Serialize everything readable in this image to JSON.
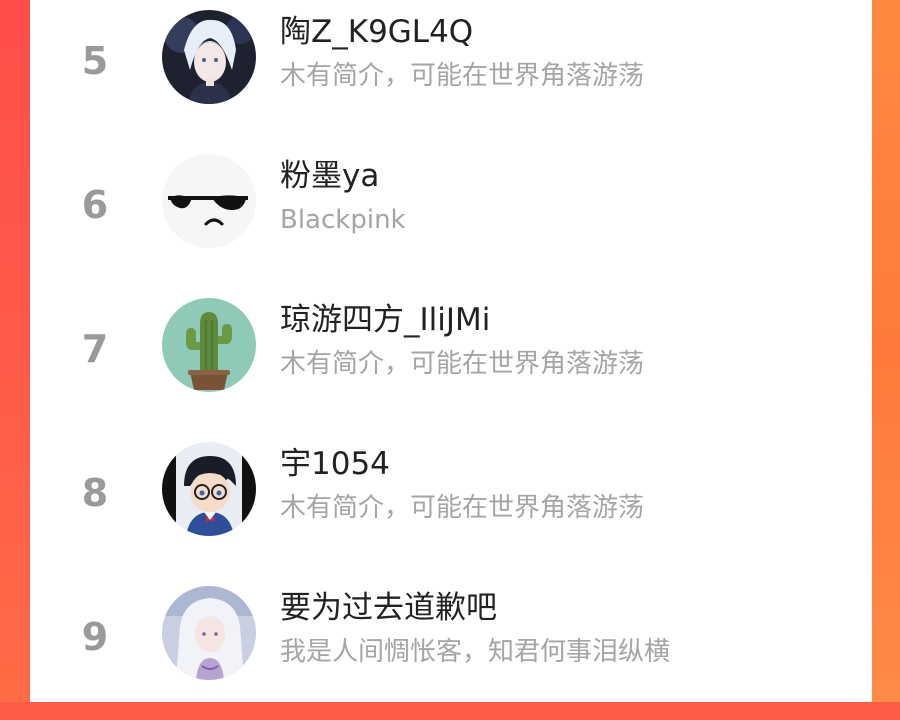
{
  "ranking": {
    "items": [
      {
        "rank": "5",
        "name": "陶Z_K9GL4Q",
        "desc": "木有简介，可能在世界角落游荡",
        "avatar": "anime-boy-avatar"
      },
      {
        "rank": "6",
        "name": "粉墨ya",
        "desc": "Blackpink",
        "avatar": "sunglasses-face-avatar"
      },
      {
        "rank": "7",
        "name": "琼游四方_IliJMi",
        "desc": "木有简介，可能在世界角落游荡",
        "avatar": "cactus-avatar"
      },
      {
        "rank": "8",
        "name": "宇1054",
        "desc": "木有简介，可能在世界角落游荡",
        "avatar": "detective-conan-avatar"
      },
      {
        "rank": "9",
        "name": "要为过去道歉吧",
        "desc": "我是人间惆怅客，知君何事泪纵横",
        "avatar": "white-hair-anime-avatar"
      }
    ]
  },
  "colors": {
    "background_left": "#ff4d4a",
    "background_right": "#ff8a3f",
    "panel": "#ffffff",
    "rank_text": "#9a9a9a",
    "name_text": "#222222",
    "desc_text": "#a5a5a5"
  }
}
